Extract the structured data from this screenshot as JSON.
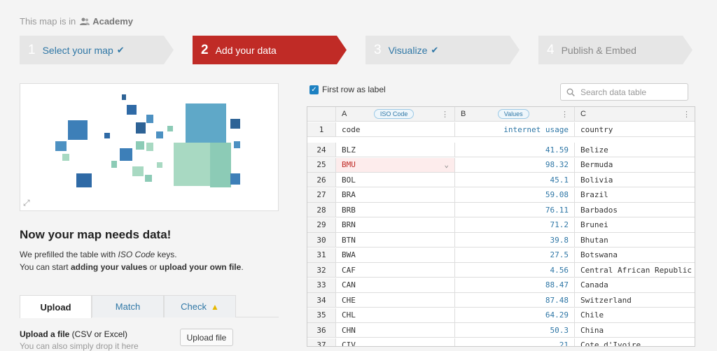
{
  "header": {
    "breadcrumb_text": "This map is in",
    "team_name": "Academy",
    "team_icon": "users-icon"
  },
  "steps": [
    {
      "num": "1",
      "label": "Select your map",
      "state": "done"
    },
    {
      "num": "2",
      "label": "Add your data",
      "state": "active"
    },
    {
      "num": "3",
      "label": "Visualize",
      "state": "done"
    },
    {
      "num": "4",
      "label": "Publish & Embed",
      "state": "todo"
    }
  ],
  "left": {
    "heading": "Now your map needs data!",
    "intro_line1_prefix": "We prefilled the table with ",
    "intro_line1_em": "ISO Code",
    "intro_line1_suffix": " keys.",
    "intro_line2_prefix": "You can start ",
    "intro_line2_b1": "adding your values",
    "intro_line2_mid": " or ",
    "intro_line2_b2": "upload your own file",
    "intro_line2_suffix": ".",
    "tabs": {
      "upload": "Upload",
      "match": "Match",
      "check": "Check"
    },
    "upload_label_bold": "Upload a file",
    "upload_label_rest": " (CSV or Excel)",
    "upload_sub": "You can also simply drop it here",
    "upload_button": "Upload file"
  },
  "table": {
    "first_row_label": "First row as label",
    "search_placeholder": "Search data table",
    "columns": [
      {
        "letter": "A",
        "tag": "ISO Code"
      },
      {
        "letter": "B",
        "tag": "Values"
      },
      {
        "letter": "C",
        "tag": ""
      }
    ],
    "label_row": {
      "num": "1",
      "a": "code",
      "b": "internet usage",
      "c": "country"
    },
    "rows": [
      {
        "num": "24",
        "a": "BLZ",
        "b": "41.59",
        "c": "Belize"
      },
      {
        "num": "25",
        "a": "BMU",
        "b": "98.32",
        "c": "Bermuda"
      },
      {
        "num": "26",
        "a": "BOL",
        "b": "45.1",
        "c": "Bolivia"
      },
      {
        "num": "27",
        "a": "BRA",
        "b": "59.08",
        "c": "Brazil"
      },
      {
        "num": "28",
        "a": "BRB",
        "b": "76.11",
        "c": "Barbados"
      },
      {
        "num": "29",
        "a": "BRN",
        "b": "71.2",
        "c": "Brunei"
      },
      {
        "num": "30",
        "a": "BTN",
        "b": "39.8",
        "c": "Bhutan"
      },
      {
        "num": "31",
        "a": "BWA",
        "b": "27.5",
        "c": "Botswana"
      },
      {
        "num": "32",
        "a": "CAF",
        "b": "4.56",
        "c": "Central African Republic"
      },
      {
        "num": "33",
        "a": "CAN",
        "b": "88.47",
        "c": "Canada"
      },
      {
        "num": "34",
        "a": "CHE",
        "b": "87.48",
        "c": "Switzerland"
      },
      {
        "num": "35",
        "a": "CHL",
        "b": "64.29",
        "c": "Chile"
      },
      {
        "num": "36",
        "a": "CHN",
        "b": "50.3",
        "c": "China"
      },
      {
        "num": "37",
        "a": "CIV",
        "b": "21",
        "c": "Cote d'Ivoire"
      }
    ],
    "highlighted_row": "25"
  },
  "colors": {
    "accent": "#c02b26",
    "link": "#2f77a6"
  }
}
